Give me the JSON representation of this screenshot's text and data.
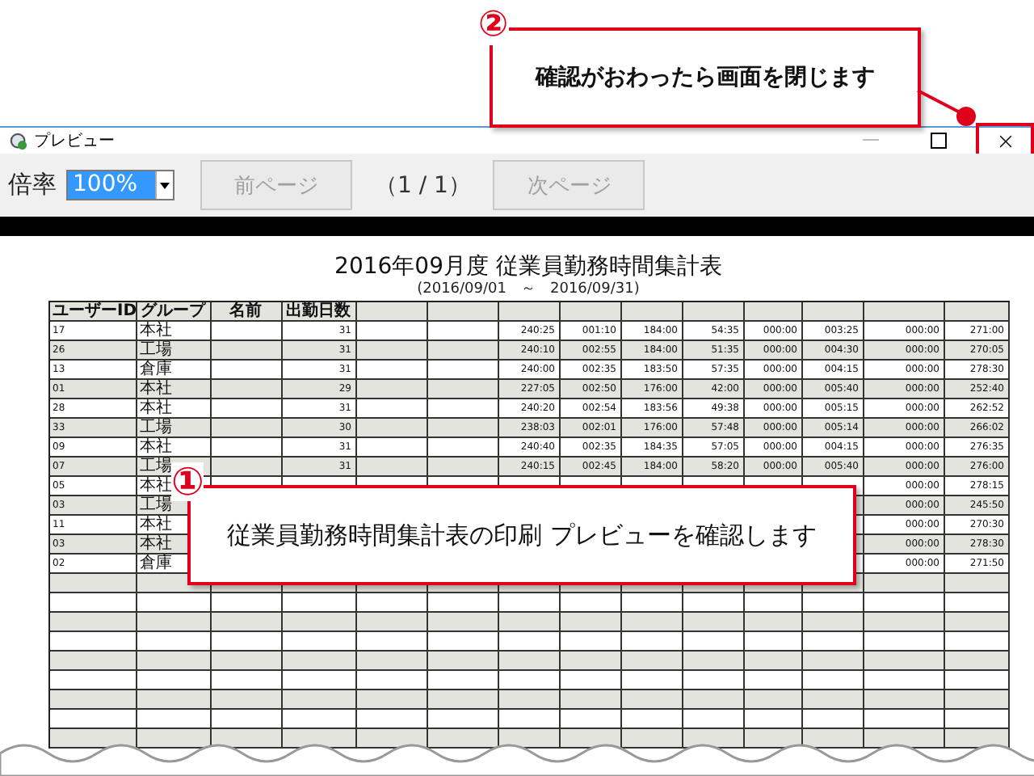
{
  "window": {
    "title": "プレビュー"
  },
  "toolbar": {
    "zoom_label": "倍率",
    "zoom_value": "100%",
    "prev_button": {
      "label": "前ページ",
      "disabled": true
    },
    "page_indicator": "（1 / 1）",
    "next_button": {
      "label": "次ページ",
      "disabled": true
    }
  },
  "report": {
    "title": "2016年09月度  従業員勤務時間集計表",
    "period": "(2016/09/01　～　2016/09/31)",
    "columns": [
      {
        "label": "ユーザーID"
      },
      {
        "label": "グループ"
      },
      {
        "label": "名前"
      },
      {
        "label": "出勤日数"
      },
      {},
      {},
      {},
      {},
      {},
      {},
      {},
      {},
      {},
      {}
    ],
    "rows": [
      {
        "id": "17",
        "group": "本社",
        "values": [
          "31",
          "240:25",
          "001:10",
          "184:00",
          "54:35",
          "000:00",
          "003:25",
          "000:00",
          "271:00"
        ]
      },
      {
        "id": "26",
        "group": "工場",
        "values": [
          "31",
          "240:10",
          "002:55",
          "184:00",
          "51:35",
          "000:00",
          "004:30",
          "000:00",
          "270:05"
        ]
      },
      {
        "id": "13",
        "group": "倉庫",
        "values": [
          "31",
          "240:00",
          "002:35",
          "183:50",
          "57:35",
          "000:00",
          "004:15",
          "000:00",
          "278:30"
        ]
      },
      {
        "id": "01",
        "group": "本社",
        "values": [
          "29",
          "227:05",
          "002:50",
          "176:00",
          "42:00",
          "000:00",
          "005:40",
          "000:00",
          "252:40"
        ]
      },
      {
        "id": "28",
        "group": "本社",
        "values": [
          "31",
          "240:20",
          "002:54",
          "183:56",
          "49:38",
          "000:00",
          "005:15",
          "000:00",
          "262:52"
        ]
      },
      {
        "id": "33",
        "group": "工場",
        "values": [
          "30",
          "238:03",
          "002:01",
          "176:00",
          "57:48",
          "000:00",
          "005:14",
          "000:00",
          "266:02"
        ]
      },
      {
        "id": "09",
        "group": "本社",
        "values": [
          "31",
          "240:40",
          "002:35",
          "184:35",
          "57:05",
          "000:00",
          "004:15",
          "000:00",
          "276:35"
        ]
      },
      {
        "id": "07",
        "group": "工場",
        "values": [
          "31",
          "240:15",
          "002:45",
          "184:00",
          "58:20",
          "000:00",
          "005:40",
          "000:00",
          "276:00"
        ]
      },
      {
        "id": "05",
        "group": "本社",
        "tail": [
          "000:00",
          "278:15"
        ]
      },
      {
        "id": "03",
        "group": "工場",
        "tail": [
          "000:00",
          "245:50"
        ]
      },
      {
        "id": "11",
        "group": "本社",
        "tail": [
          "000:00",
          "270:30"
        ]
      },
      {
        "id": "03",
        "group": "本社",
        "tail": [
          "000:00",
          "278:30"
        ]
      },
      {
        "id": "02",
        "group": "倉庫",
        "tail": [
          "000:00",
          "271:50"
        ]
      }
    ]
  },
  "callouts": [
    {
      "number": "②",
      "text": "確認がおわったら画面を閉じます"
    },
    {
      "number": "①",
      "text": "従業員勤務時間集計表の印刷 プレビューを確認します"
    }
  ]
}
